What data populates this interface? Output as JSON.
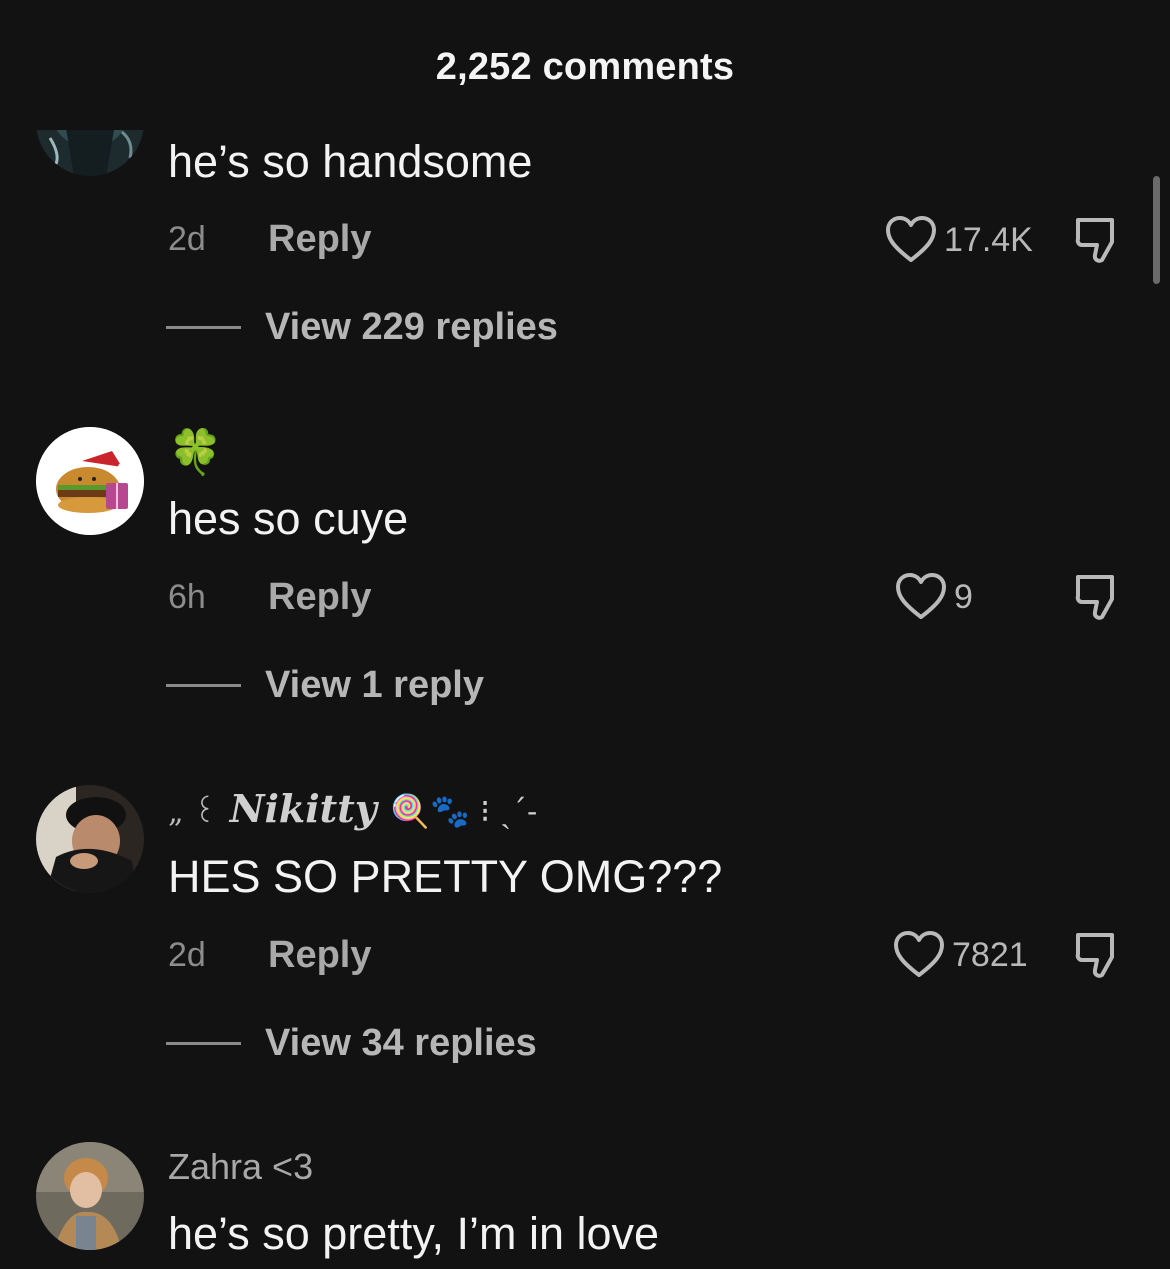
{
  "header": {
    "title": "2,252 comments"
  },
  "comments": [
    {
      "text": "he’s so handsome",
      "time": "2d",
      "reply_label": "Reply",
      "likes": "17.4K",
      "view_replies": "View 229 replies"
    },
    {
      "username_emoji": "🍀",
      "text": "hes so cuye",
      "time": "6h",
      "reply_label": "Reply",
      "likes": "9",
      "view_replies": "View 1 reply"
    },
    {
      "username_prefix": "„ ꒰",
      "username_name": "Nikitty",
      "username_suffix": "🍭🐾 ⁝ ˎˊ˗",
      "text": "HES SO PRETTY OMG???",
      "time": "2d",
      "reply_label": "Reply",
      "likes": "7821",
      "view_replies": "View 34 replies"
    },
    {
      "username": "Zahra <3",
      "text": "he’s so pretty, I’m in love"
    }
  ],
  "icons": {
    "close": "close-icon",
    "like": "heart-outline-icon",
    "dislike": "thumbs-down-icon"
  },
  "colors": {
    "background": "#121212",
    "text_primary": "#f3f3f3",
    "text_secondary": "#a8a8a8"
  }
}
